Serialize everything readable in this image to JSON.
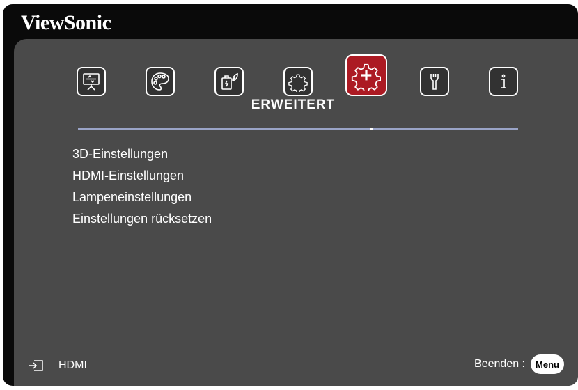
{
  "brand": "ViewSonic",
  "tabs": [
    {
      "name": "display-icon",
      "active": false
    },
    {
      "name": "palette-icon",
      "active": false
    },
    {
      "name": "power-eco-icon",
      "active": false
    },
    {
      "name": "gear-icon",
      "active": false
    },
    {
      "name": "advanced-gear-plus-icon",
      "active": true
    },
    {
      "name": "wrench-icon",
      "active": false
    },
    {
      "name": "info-icon",
      "active": false
    }
  ],
  "section_title": "ERWEITERT",
  "menu_items": [
    "3D-Einstellungen",
    "HDMI-Einstellungen",
    "Lampeneinstellungen",
    "Einstellungen rücksetzen"
  ],
  "footer": {
    "source_label": "HDMI",
    "exit_label": "Beenden :",
    "menu_button_label": "Menu"
  },
  "colors": {
    "panel": "#4a4a4a",
    "frame": "#0a0a0a",
    "active_tab": "#ac1a23",
    "divider": "#9aa4c7"
  }
}
